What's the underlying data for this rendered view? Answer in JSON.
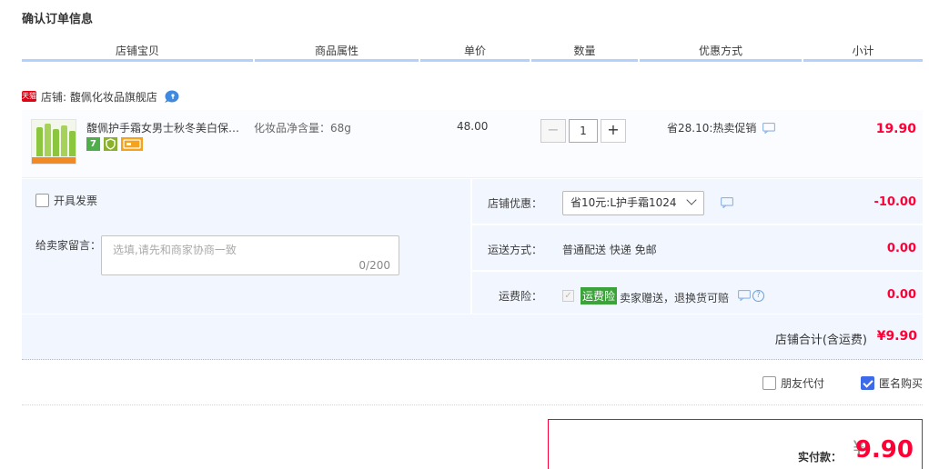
{
  "page": {
    "title": "确认订单信息"
  },
  "columns": [
    "店铺宝贝",
    "商品属性",
    "单价",
    "数量",
    "优惠方式",
    "小计"
  ],
  "shop": {
    "badge": "天猫",
    "label": "店铺: 馥佩化妆品旗舰店"
  },
  "item": {
    "title": "馥佩护手霜女男士秋冬美白保湿补水滋润",
    "attr": "化妆品净含量：68g",
    "unit_price": "48.00",
    "quantity": "1",
    "minus": "−",
    "plus": "+",
    "promo": "省28.10:热卖促销",
    "subtotal": "19.90",
    "thumb_text": "购1送1 实惠装"
  },
  "invoice": {
    "label": "开具发票"
  },
  "message": {
    "label": "给卖家留言：",
    "placeholder": "选填,请先和商家协商一致",
    "count": "0/200"
  },
  "discount": {
    "label": "店铺优惠：",
    "selected": "省10元:L护手霜1024",
    "value": "-10.00"
  },
  "shipping": {
    "label": "运送方式：",
    "method": "普通配送 快递 免邮",
    "value": "0.00"
  },
  "insurance": {
    "label": "运费险：",
    "badge": "运费险",
    "desc": "卖家赠送，退换货可赔",
    "value": "0.00",
    "help": "?"
  },
  "shop_total": {
    "label": "店铺合计(含运费)",
    "value": "¥9.90"
  },
  "options": {
    "friend_pay": "朋友代付",
    "anonymous": "匿名购买",
    "anonymous_checked": true
  },
  "pay": {
    "label": "实付款：",
    "currency": "¥",
    "value": "9.90"
  }
}
